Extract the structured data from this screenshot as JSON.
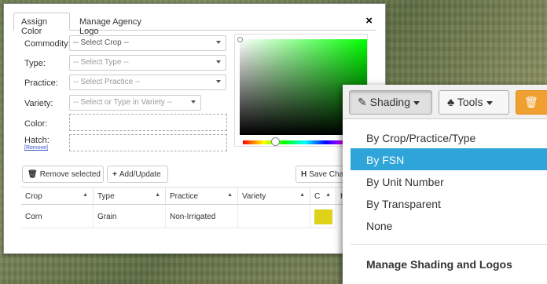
{
  "tabs": [
    {
      "label": "Assign Color",
      "active": true
    },
    {
      "label": "Manage Agency Logo",
      "active": false
    }
  ],
  "close_label": "×",
  "form": {
    "commodity": {
      "label": "Commodity:",
      "value": "-- Select Crop --"
    },
    "type": {
      "label": "Type:",
      "value": "-- Select Type --"
    },
    "practice": {
      "label": "Practice:",
      "value": "-- Select Practice --"
    },
    "variety": {
      "label": "Variety:",
      "value": "-- Select or Type in Variety --"
    },
    "color": {
      "label": "Color:"
    },
    "hatch": {
      "label": "Hatch:",
      "remove_link": "[Remove]"
    }
  },
  "picker": {
    "hue_color": "#00ff00"
  },
  "buttons": {
    "remove_selected": "Remove selected",
    "add_update": "Add/Update",
    "save": "Save Cha"
  },
  "grid": {
    "headers": [
      "Crop",
      "Type",
      "Practice",
      "Variety",
      "C",
      "H"
    ],
    "rows": [
      {
        "crop": "Corn",
        "type": "Grain",
        "practice": "Non-Irrigated",
        "variety": "",
        "color": "#e0d11b"
      }
    ]
  },
  "toolbar": {
    "shading": "Shading",
    "tools": "Tools"
  },
  "shading_menu": {
    "items": [
      {
        "label": "By Crop/Practice/Type",
        "highlighted": false
      },
      {
        "label": "By FSN",
        "highlighted": true
      },
      {
        "label": "By Unit Number",
        "highlighted": false
      },
      {
        "label": "By Transparent",
        "highlighted": false
      },
      {
        "label": "None",
        "highlighted": false
      }
    ],
    "footer": "Manage Shading and Logos"
  }
}
